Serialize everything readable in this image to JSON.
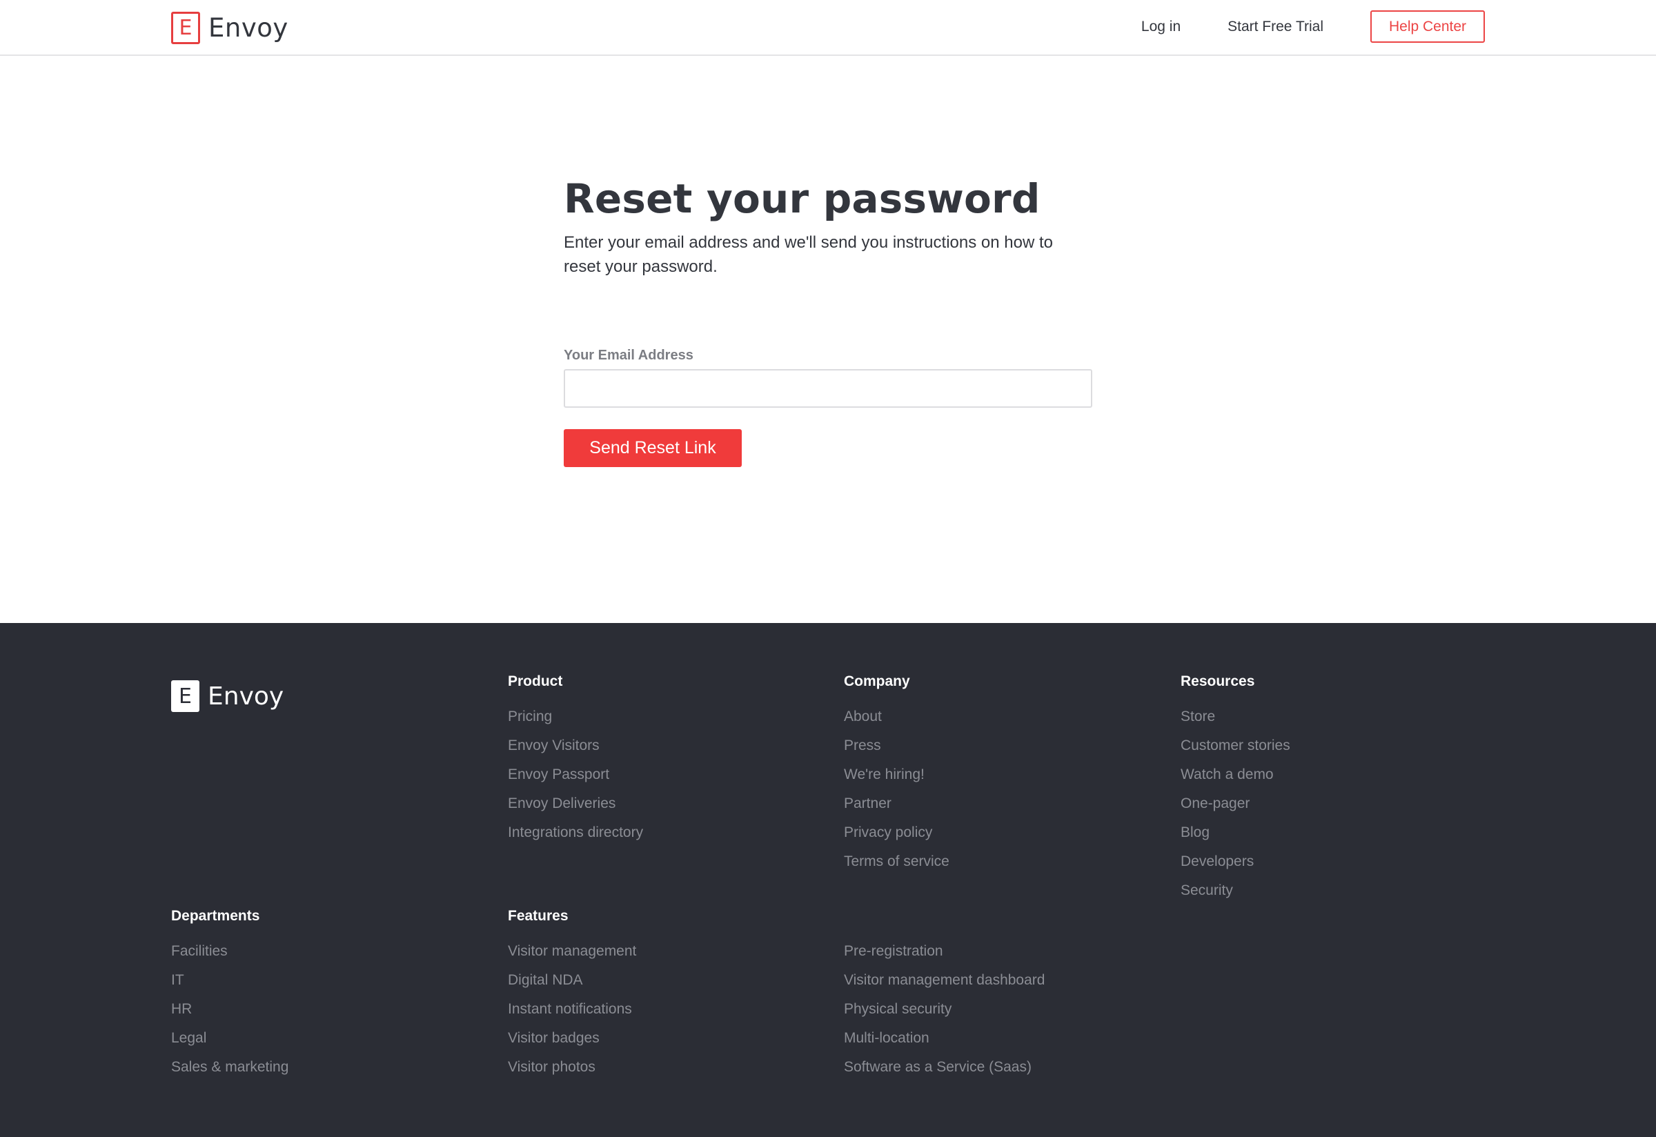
{
  "header": {
    "logo_letter": "E",
    "logo_text": "Envoy",
    "nav": {
      "login": "Log in",
      "trial": "Start Free Trial",
      "help": "Help Center"
    }
  },
  "main": {
    "title": "Reset your password",
    "description": "Enter your email address and we'll send you instructions on how to reset your password.",
    "email_label": "Your Email Address",
    "email_value": "",
    "submit_label": "Send Reset Link"
  },
  "footer": {
    "logo_letter": "E",
    "logo_text": "Envoy",
    "product": {
      "heading": "Product",
      "links": [
        "Pricing",
        "Envoy Visitors",
        "Envoy Passport",
        "Envoy Deliveries",
        "Integrations directory"
      ]
    },
    "company": {
      "heading": "Company",
      "links": [
        "About",
        "Press",
        "We're hiring!",
        "Partner",
        "Privacy policy",
        "Terms of service"
      ]
    },
    "resources": {
      "heading": "Resources",
      "links": [
        "Store",
        "Customer stories",
        "Watch a demo",
        "One-pager",
        "Blog",
        "Developers",
        "Security"
      ]
    },
    "departments": {
      "heading": "Departments",
      "links": [
        "Facilities",
        "IT",
        "HR",
        "Legal",
        "Sales & marketing"
      ]
    },
    "features": {
      "heading": "Features",
      "links": [
        "Visitor management",
        "Digital NDA",
        "Instant notifications",
        "Visitor badges",
        "Visitor photos"
      ]
    },
    "features_more": {
      "links": [
        "Pre-registration",
        "Visitor management dashboard",
        "Physical security",
        "Multi-location",
        "Software as a Service (Saas)"
      ]
    }
  }
}
